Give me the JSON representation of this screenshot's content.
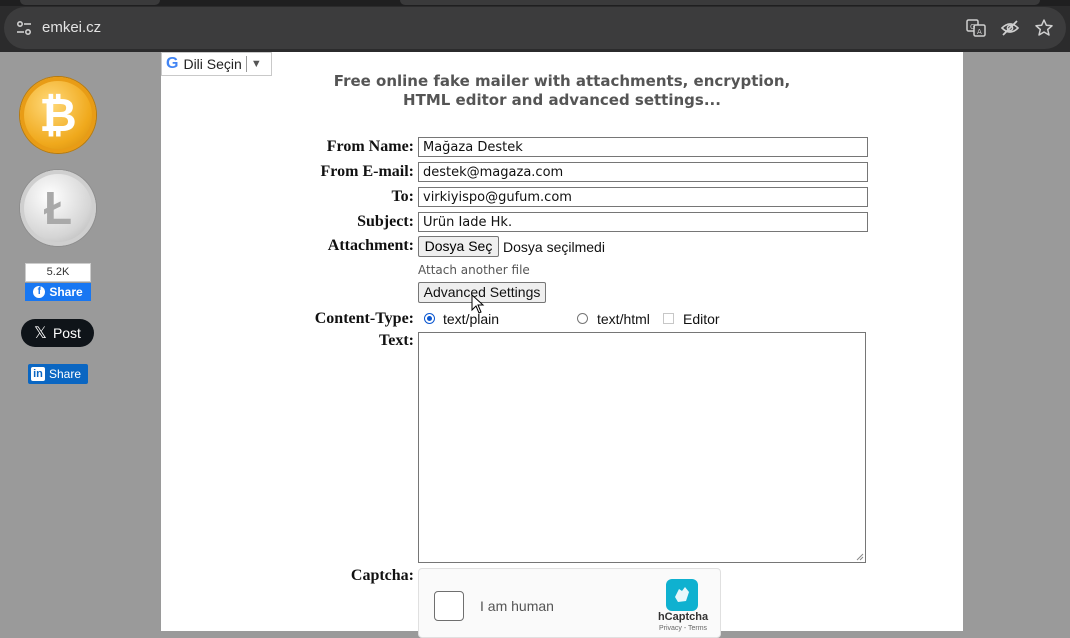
{
  "browser": {
    "url": "emkei.cz",
    "icons": [
      "site-settings-icon",
      "translate-icon",
      "eye-slash-icon",
      "bookmark-star-icon"
    ]
  },
  "translate": {
    "brand": "G",
    "label": "Dili Seçin",
    "arrow": "▼"
  },
  "sidebar": {
    "bitcoin_symbol": "₿",
    "litecoin_symbol": "Ł",
    "facebook": {
      "count": "5.2K",
      "label": "Share"
    },
    "x": {
      "label": "Post"
    },
    "linkedin": {
      "label": "Share"
    }
  },
  "header": {
    "line1": "Free online fake mailer with attachments, encryption,",
    "line2": "HTML editor and advanced settings..."
  },
  "form": {
    "from_name": {
      "label": "From Name:",
      "value": "Mağaza Destek"
    },
    "from_email": {
      "label": "From E-mail:",
      "value": "destek@magaza.com"
    },
    "to": {
      "label": "To:",
      "value": "virkiyispo@gufum.com"
    },
    "subject": {
      "label": "Subject:",
      "value": "Ürün İade Hk."
    },
    "attachment": {
      "label": "Attachment:",
      "button": "Dosya Seç",
      "status": "Dosya seçilmedi",
      "another": "Attach another file"
    },
    "advanced_button": "Advanced Settings",
    "content_type": {
      "label": "Content-Type:",
      "options": [
        {
          "label": "text/plain",
          "selected": true
        },
        {
          "label": "text/html",
          "selected": false
        }
      ],
      "editor_label": "Editor"
    },
    "text": {
      "label": "Text:",
      "value": ""
    },
    "captcha": {
      "label": "Captcha:",
      "checkbox_label": "I am human",
      "brand": "hCaptcha",
      "terms": "Privacy - Terms"
    }
  }
}
